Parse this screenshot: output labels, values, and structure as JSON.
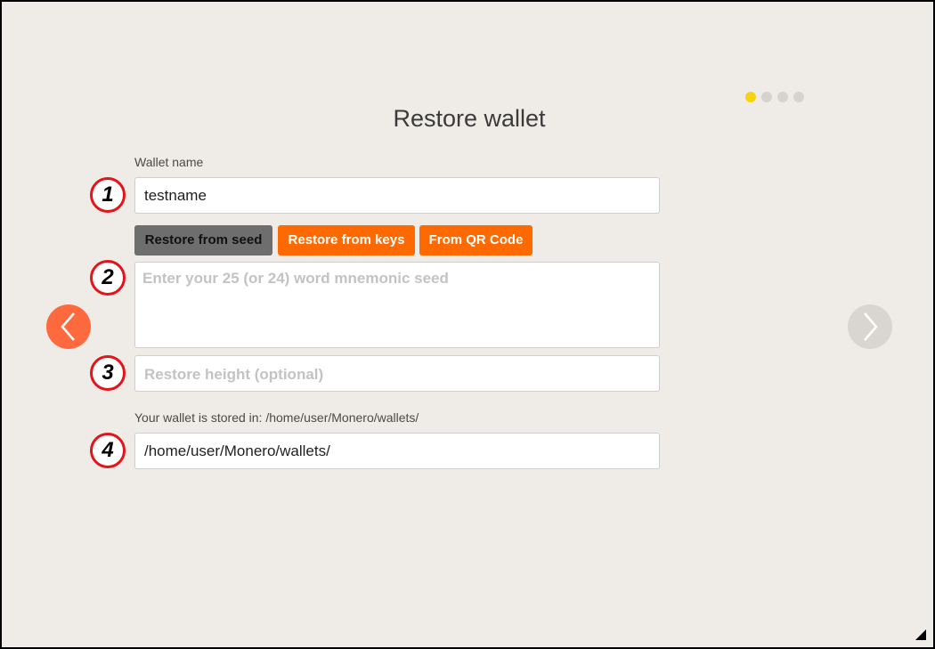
{
  "page": {
    "title": "Restore wallet",
    "progress": {
      "steps": 4,
      "current": 1
    }
  },
  "wallet_name": {
    "label": "Wallet name",
    "value": "testname",
    "marker": "1"
  },
  "restore_tabs": [
    {
      "label": "Restore from seed",
      "active": true
    },
    {
      "label": "Restore from keys",
      "active": false
    },
    {
      "label": "From QR Code",
      "active": false
    }
  ],
  "seed_input": {
    "placeholder": "Enter your 25 (or 24) word mnemonic seed",
    "marker": "2"
  },
  "restore_height": {
    "placeholder": "Restore height (optional)",
    "marker": "3"
  },
  "storage": {
    "label": "Your wallet is stored in: /home/user/Monero/wallets/",
    "path": "/home/user/Monero/wallets/",
    "marker": "4"
  },
  "navigation": {
    "prev_icon": "chevron-left-icon",
    "next_icon": "chevron-right-icon"
  },
  "colors": {
    "background": "#efebe7",
    "accent": "#ff6a00",
    "prev_button": "#fe6a3d",
    "active_dot": "#f5d40f",
    "marker_ring": "#e4141b"
  }
}
